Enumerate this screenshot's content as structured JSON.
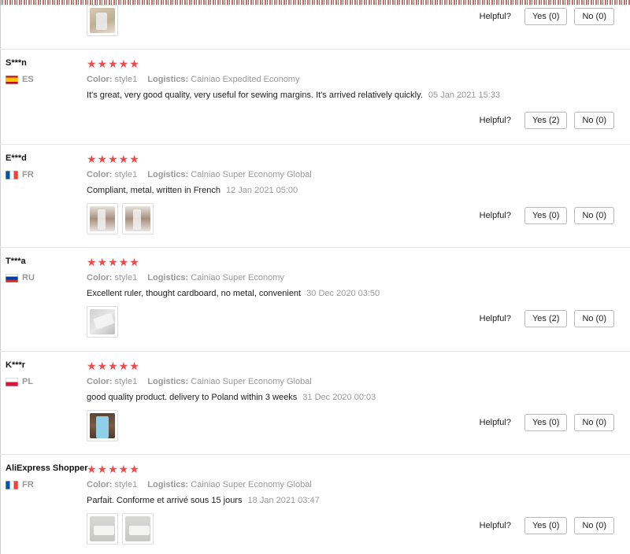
{
  "helpful_label": "Helpful?",
  "labels": {
    "color": "Color:",
    "logistics": "Logistics:"
  },
  "stars_glyph": "★★★★★",
  "reviews": [
    {
      "yes": "Yes (0)",
      "no": "No (0)",
      "thumbnails": [
        "beige"
      ]
    },
    {
      "user": "S***n",
      "country": "ES",
      "flag": "es",
      "rating": 5,
      "color": "style1",
      "logistics": "Cainiao Expedited Economy",
      "text": "It's great, very good quality, very useful for sewing margins. It's arrived relatively quickly.",
      "date": "05 Jan 2021 15:33",
      "yes": "Yes (2)",
      "no": "No (0)",
      "thumbnails": []
    },
    {
      "user": "E***d",
      "country": "FR",
      "flag": "fr",
      "rating": 5,
      "color": "style1",
      "logistics": "Cainiao Super Economy Global",
      "text": "Compliant, metal, written in French",
      "date": "12 Jan 2021 05:00",
      "yes": "Yes (0)",
      "no": "No (0)",
      "thumbnails": [
        "tan",
        "tan"
      ]
    },
    {
      "user": "T***a",
      "country": "RU",
      "flag": "ru",
      "rating": 5,
      "color": "style1",
      "logistics": "Cainiao Super Economy",
      "text": "Excellent ruler, thought cardboard, no metal, convenient",
      "date": "30 Dec 2020 03:50",
      "yes": "Yes (2)",
      "no": "No (0)",
      "thumbnails": [
        "grey"
      ]
    },
    {
      "user": "K***r",
      "country": "PL",
      "flag": "pl",
      "rating": 5,
      "color": "style1",
      "logistics": "Cainiao Super Economy Global",
      "text": "good quality product. delivery to Poland within 3 weeks",
      "date": "31 Dec 2020 00:03",
      "yes": "Yes (0)",
      "no": "No (0)",
      "thumbnails": [
        "blue"
      ]
    },
    {
      "user": "AliExpress Shopper",
      "country": "FR",
      "flag": "fr",
      "rating": 5,
      "color": "style1",
      "logistics": "Cainiao Super Economy Global",
      "text": "Parfait. Conforme et arrivé sous 15 jours",
      "date": "18 Jan 2021 03:47",
      "yes": "Yes (0)",
      "no": "No (0)",
      "thumbnails": [
        "white",
        "white"
      ]
    }
  ],
  "colors": {
    "star": "#f04b4b",
    "muted": "#999999",
    "divider": "#e6e6e6"
  }
}
